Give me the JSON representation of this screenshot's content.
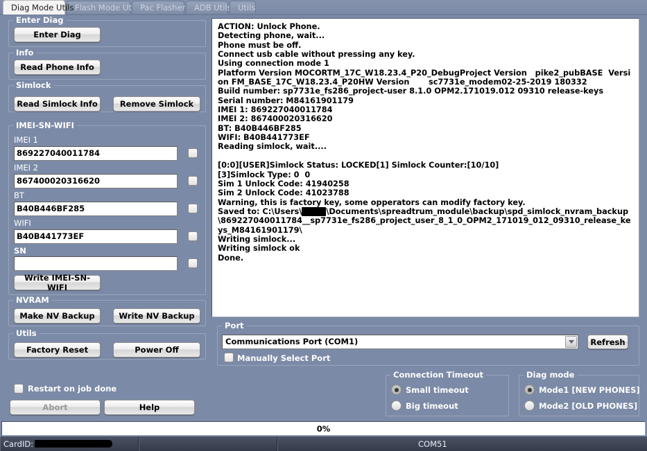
{
  "window": {
    "title": "Diag Mode Utils",
    "bg_color": "#7b8aa6",
    "accent_color": "#ffffff"
  },
  "tabs": [
    {
      "id": "diag-mode-utils",
      "label": "Diag Mode Utils",
      "active": true
    },
    {
      "id": "flash-mode-utils",
      "label": "Flash Mode Utils",
      "active": false
    },
    {
      "id": "pac-flasher",
      "label": "Pac Flasher",
      "active": false
    },
    {
      "id": "adb-utils",
      "label": "ADB Utils",
      "active": false
    },
    {
      "id": "utils",
      "label": "Utils",
      "active": false
    }
  ],
  "groups": {
    "enter_diag": {
      "caption": "Enter Diag",
      "buttons": [
        {
          "label": "Enter Diag"
        }
      ]
    },
    "info": {
      "caption": "Info",
      "buttons": [
        {
          "label": "Read Phone Info"
        }
      ]
    },
    "simlock": {
      "caption": "Simlock",
      "buttons": [
        {
          "label": "Read Simlock Info"
        },
        {
          "label": "Remove Simlock"
        }
      ]
    },
    "imei_sn_wifi": {
      "caption": "IMEI-SN-WIFI",
      "fields": [
        {
          "label": "IMEI 1",
          "value": "869227040011784",
          "checked": false
        },
        {
          "label": "IMEI 2",
          "value": "867400020316620",
          "checked": false
        },
        {
          "label": "BT",
          "value": "B40B446BF285",
          "checked": false
        },
        {
          "label": "WIFI",
          "value": "B40B441773EF",
          "checked": false
        },
        {
          "label": "SN",
          "value": "",
          "checked": false
        }
      ],
      "write_button": "Write IMEI-SN-WIFI"
    },
    "nvram": {
      "caption": "NVRAM",
      "buttons": [
        {
          "label": "Make NV Backup"
        },
        {
          "label": "Write NV Backup"
        }
      ]
    },
    "utils": {
      "caption": "Utils",
      "buttons": [
        {
          "label": "Factory Reset"
        },
        {
          "label": "Power Off"
        }
      ]
    },
    "port": {
      "caption": "Port",
      "selected": "Communications Port (COM1)",
      "options": [
        "Communications Port (COM1)"
      ],
      "refresh_label": "Refresh",
      "manual_checkbox": {
        "label": "Manually Select Port",
        "checked": false
      }
    },
    "connection_timeout": {
      "caption": "Connection Timeout",
      "options": [
        {
          "label": "Small timeout",
          "selected": true
        },
        {
          "label": "Big timeout",
          "selected": false
        }
      ]
    },
    "diag_mode": {
      "caption": "Diag mode",
      "options": [
        {
          "label": "Mode1  [NEW PHONES]",
          "selected": true
        },
        {
          "label": "Mode2 [OLD PHONES]",
          "selected": false
        }
      ]
    }
  },
  "footer": {
    "restart_checkbox": {
      "label": "Restart on job done",
      "checked": false
    },
    "abort_label": "Abort",
    "abort_disabled": true,
    "help_label": "Help"
  },
  "progress": {
    "percent_label": "0%",
    "value": 0
  },
  "statusbar": {
    "card_id_label": "CardID:",
    "card_id_value": "",
    "middle": "",
    "port": "COM51"
  },
  "log": {
    "lines_pre": "ACTION: Unlock Phone.\nDetecting phone, wait...\nPhone must be off.\nConnect usb cable without pressing any key.\nUsing connection mode 1\nPlatform Version MOCORTM_17C_W18.23.4_P20_DebugProject Version   pike2_pubBASE  Version FM_BASE_17C_W18.23.4_P20HW Version       sc7731e_modem02-25-2019 180332\nBuild number: sp7731e_fs286_project-user 8.1.0 OPM2.171019.012 09310 release-keys\nSerial number: M84161901179\nIMEI 1: 869227040011784\nIMEI 2: 867400020316620\nBT: B40B446BF285\nWIFI: B40B441773EF\nReading simlock, wait....\n\n[0:0][USER]Simlock Status: LOCKED[1] Simlock Counter:[10/10]\n[3]Simlock Type: 0  0\nSim 1 Unlock Code: 41940258\nSim 2 Unlock Code: 41023788\nWarning, this is factory key, some opperators can modify factory key.\nSaved to: C:\\Users\\",
    "redacted_user": "XXXX",
    "lines_post": "\\Documents\\spreadtrum_module\\backup\\spd_simlock_nvram_backup\\869227040011784__sp7731e_fs286_project_user_8_1_0_OPM2_171019_012_09310_release_keys_M84161901179\\\nWriting simlock...\nWriting simlock ok\nDone."
  }
}
